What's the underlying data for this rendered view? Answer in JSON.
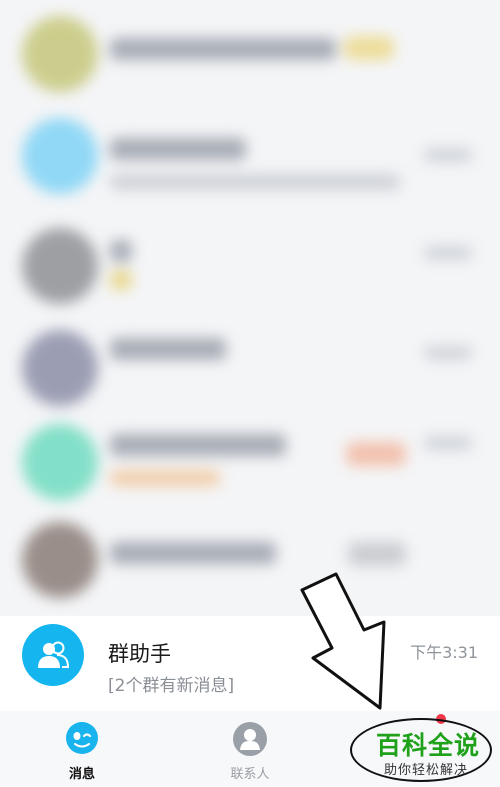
{
  "group_helper": {
    "name": "群助手",
    "preview": "[2个群有新消息]",
    "time": "下午3:31",
    "icon": "group-people-icon"
  },
  "tabs": [
    {
      "label": "消息",
      "icon": "message-bubble-icon",
      "active": true
    },
    {
      "label": "联系人",
      "icon": "contact-person-icon",
      "active": false
    }
  ],
  "watermark": {
    "title": "百科全说",
    "subtitle": "助你轻松解决"
  },
  "colors": {
    "accent": "#15b6ef",
    "watermark_green": "#1fa11a",
    "badge_red": "#f2364a"
  }
}
